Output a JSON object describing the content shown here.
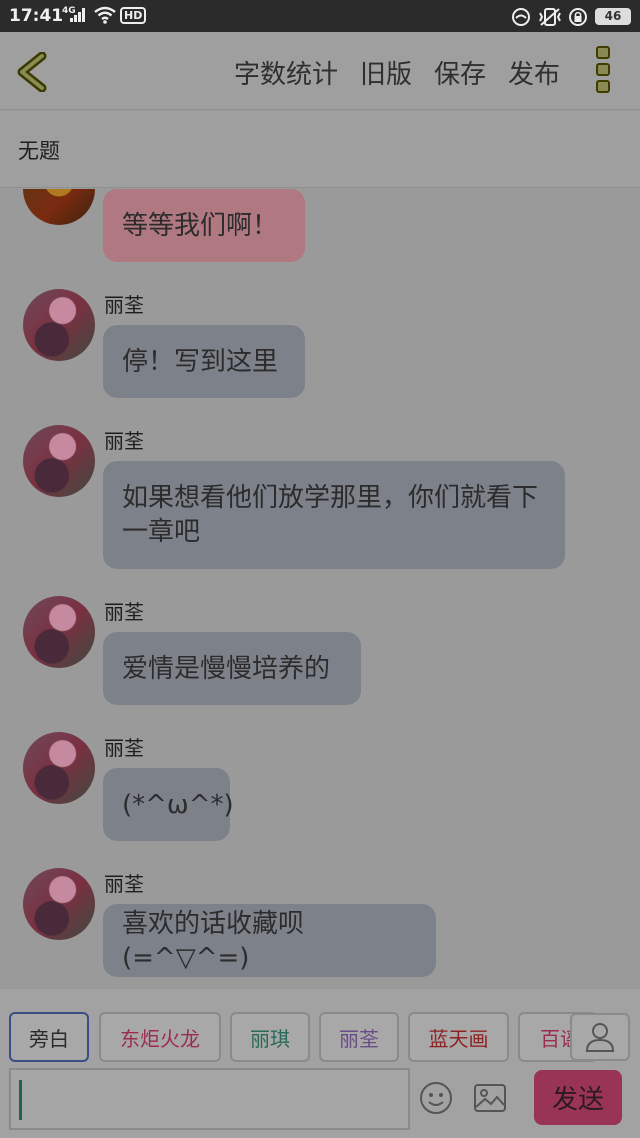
{
  "status_bar": {
    "time": "17:41",
    "signal_label": "4G",
    "hd_label": "HD",
    "battery": "46"
  },
  "app_bar": {
    "actions": [
      "字数统计",
      "旧版",
      "保存",
      "发布"
    ]
  },
  "title": "无题",
  "messages": [
    {
      "speaker": "",
      "text": "等等我们啊！",
      "color": "#b07880"
    },
    {
      "speaker": "丽荃",
      "text": "停！写到这里",
      "color": "#7d818a"
    },
    {
      "speaker": "丽荃",
      "text": "如果想看他们放学那里，你们就看下一章吧",
      "color": "#7d818a"
    },
    {
      "speaker": "丽荃",
      "text": "爱情是慢慢培养的",
      "color": "#7d818a"
    },
    {
      "speaker": "丽荃",
      "text": "(*^ω^*)",
      "color": "#7d818a"
    },
    {
      "speaker": "丽荃",
      "text": "喜欢的话收藏呗(=^▽^=)",
      "color": "#7d818a"
    }
  ],
  "characters": [
    {
      "name": "旁白",
      "color": "#2a2a2a"
    },
    {
      "name": "东炬火龙",
      "color": "#9a2d4d"
    },
    {
      "name": "丽琪",
      "color": "#2a6a58"
    },
    {
      "name": "丽荃",
      "color": "#6a4c84"
    },
    {
      "name": "蓝天画",
      "color": "#8e2222"
    },
    {
      "name": "百谣",
      "color": "#9a2d4d"
    }
  ],
  "input": {
    "value": "",
    "send_label": "发送"
  },
  "icons": [
    "back-icon",
    "more-icon",
    "person-icon",
    "emoji-icon",
    "image-icon"
  ]
}
